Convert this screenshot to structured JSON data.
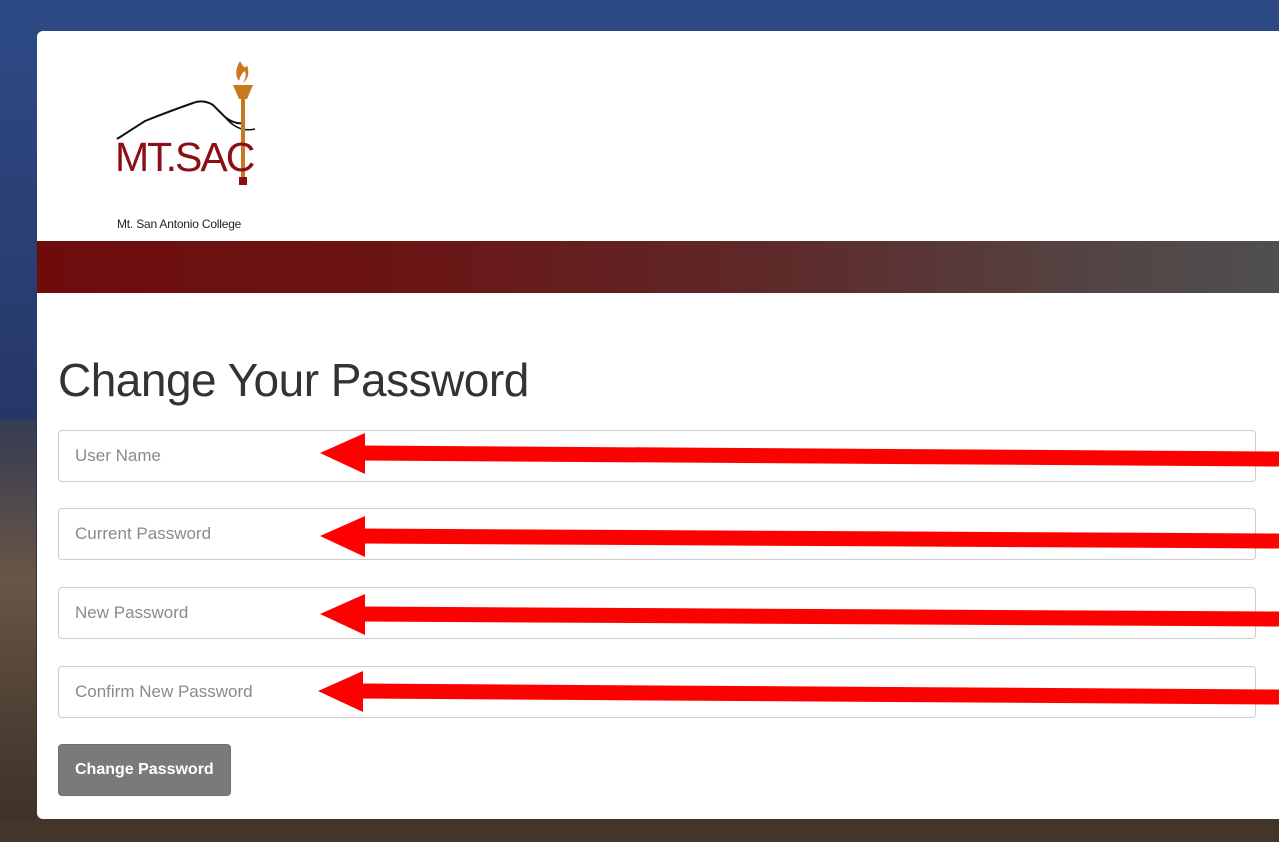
{
  "brand": {
    "logo_word": "MT.SAC",
    "logo_subtitle": "Mt. San Antonio College",
    "color_primary": "#8b0f14",
    "color_torch": "#c8781e"
  },
  "page": {
    "title": "Change Your Password"
  },
  "form": {
    "user_name_placeholder": "User Name",
    "current_password_placeholder": "Current Password",
    "new_password_placeholder": "New Password",
    "confirm_password_placeholder": "Confirm New Password",
    "submit_label": "Change Password"
  },
  "annotations": {
    "arrow_color": "#ff0000"
  }
}
